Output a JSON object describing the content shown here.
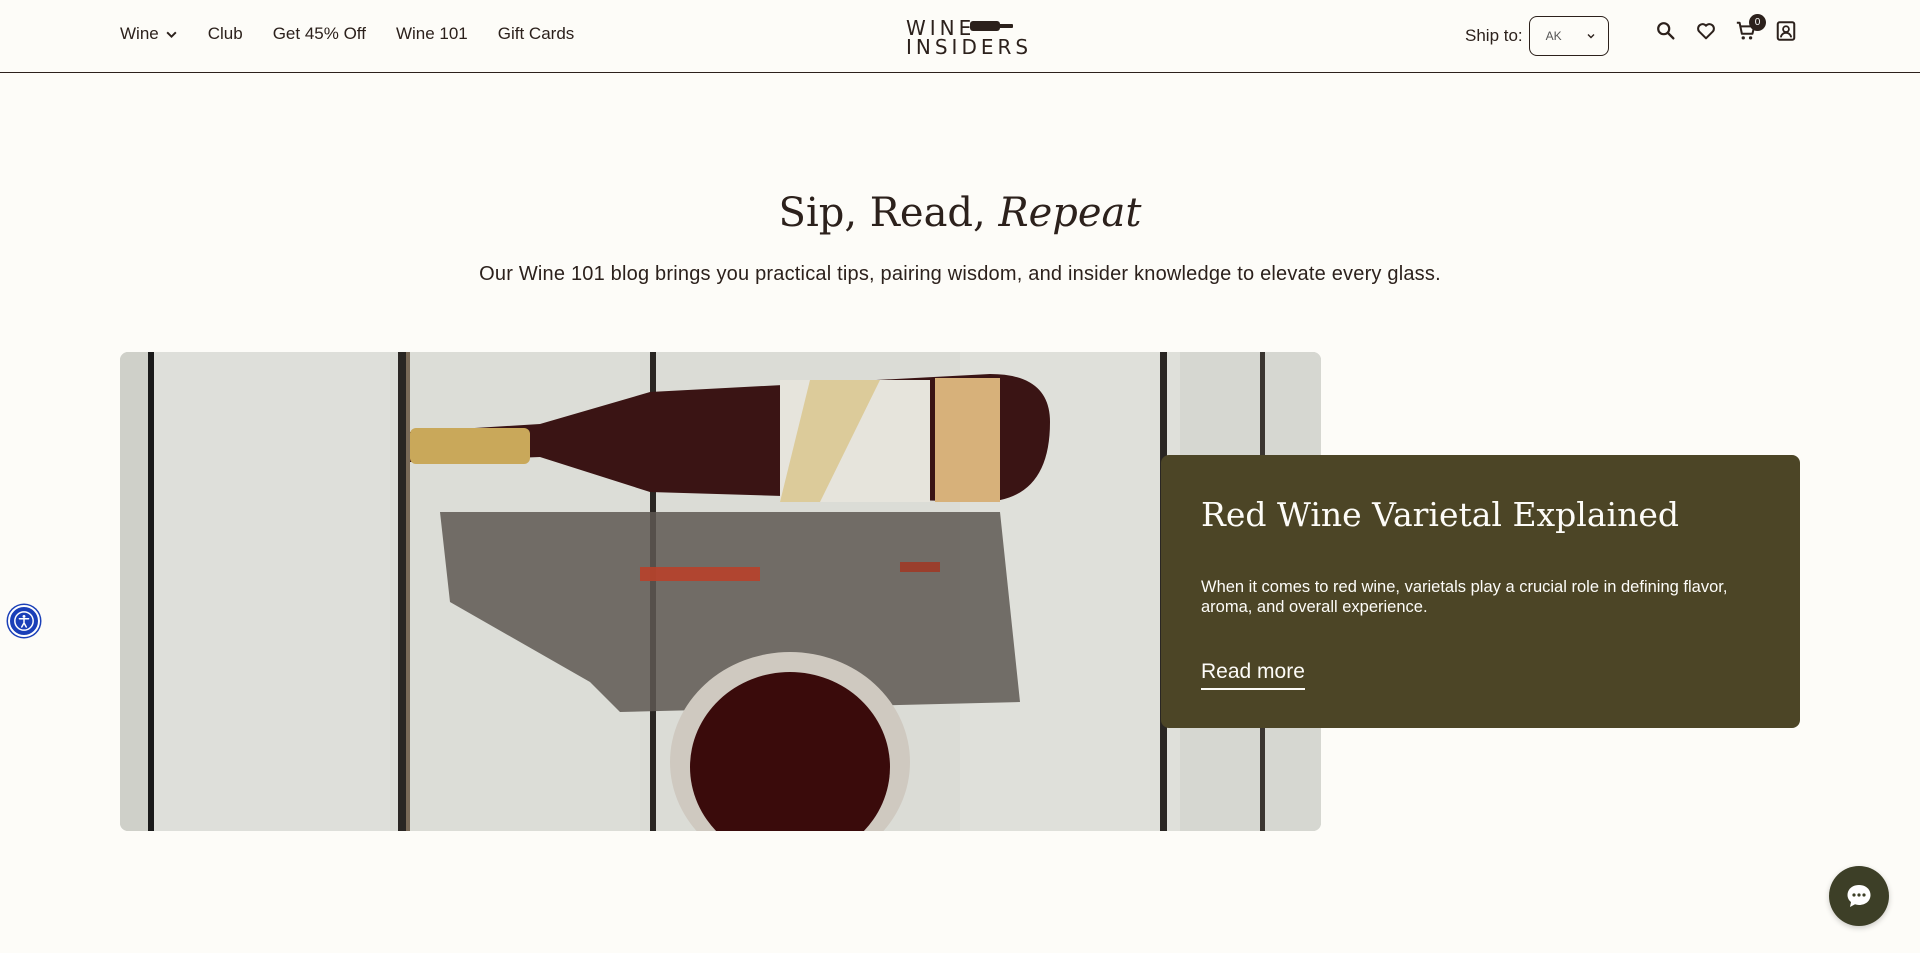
{
  "header": {
    "nav": [
      {
        "label": "Wine",
        "has_dropdown": true
      },
      {
        "label": "Club"
      },
      {
        "label": "Get 45% Off"
      },
      {
        "label": "Wine 101"
      },
      {
        "label": "Gift Cards"
      }
    ],
    "logo": {
      "line1": "WINE",
      "line2": "INSIDERS"
    },
    "ship_to": {
      "label": "Ship to:",
      "selected": "AK"
    },
    "icons": [
      "search-icon",
      "heart-icon",
      "cart-icon",
      "account-icon"
    ],
    "cart_count": "0"
  },
  "section": {
    "title_plain": "Sip, Read, ",
    "title_italic": "Repeat",
    "subtitle": "Our Wine 101 blog brings you practical tips, pairing wisdom, and insider knowledge to elevate every glass."
  },
  "feature": {
    "image": "wine-bottle-and-glass-photo",
    "title": "Red Wine Varietal Explained",
    "text": "When it comes to red wine, varietals play a crucial role in defining flavor, aroma, and overall experience.",
    "link": "Read more"
  },
  "colors": {
    "background": "#fdfcf8",
    "text": "#2c211c",
    "card": "#4c4526",
    "accessibility": "#1a3fb8",
    "chat": "#3d3f27"
  }
}
